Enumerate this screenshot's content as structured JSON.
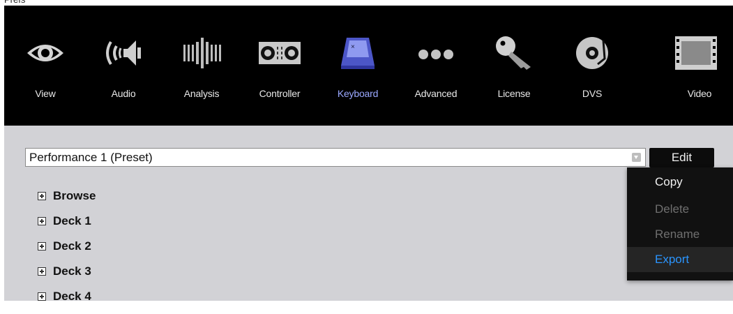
{
  "window": {
    "title": "Prefs"
  },
  "toolbar": {
    "items": [
      {
        "label": "View",
        "icon": "eye-icon",
        "active": false
      },
      {
        "label": "Audio",
        "icon": "speaker-icon",
        "active": false
      },
      {
        "label": "Analysis",
        "icon": "bars-icon",
        "active": false
      },
      {
        "label": "Controller",
        "icon": "controller-icon",
        "active": false
      },
      {
        "label": "Keyboard",
        "icon": "keyboard-key-icon",
        "active": true
      },
      {
        "label": "Advanced",
        "icon": "dots-icon",
        "active": false
      },
      {
        "label": "License",
        "icon": "key-icon",
        "active": false
      },
      {
        "label": "DVS",
        "icon": "turntable-icon",
        "active": false
      },
      {
        "label": "Video",
        "icon": "filmstrip-icon",
        "active": false
      }
    ],
    "active_color": "#9aa8ff"
  },
  "preset": {
    "value": "Performance 1 (Preset)"
  },
  "edit_button": {
    "label": "Edit"
  },
  "tree": {
    "items": [
      {
        "label": "Browse"
      },
      {
        "label": "Deck 1"
      },
      {
        "label": "Deck 2"
      },
      {
        "label": "Deck 3"
      },
      {
        "label": "Deck 4"
      }
    ]
  },
  "edit_menu": {
    "items": [
      {
        "label": "Copy",
        "state": "enabled"
      },
      {
        "label": "Delete",
        "state": "disabled"
      },
      {
        "label": "Rename",
        "state": "disabled"
      },
      {
        "label": "Export",
        "state": "selected"
      }
    ],
    "highlight_color": "#2a95ff"
  }
}
